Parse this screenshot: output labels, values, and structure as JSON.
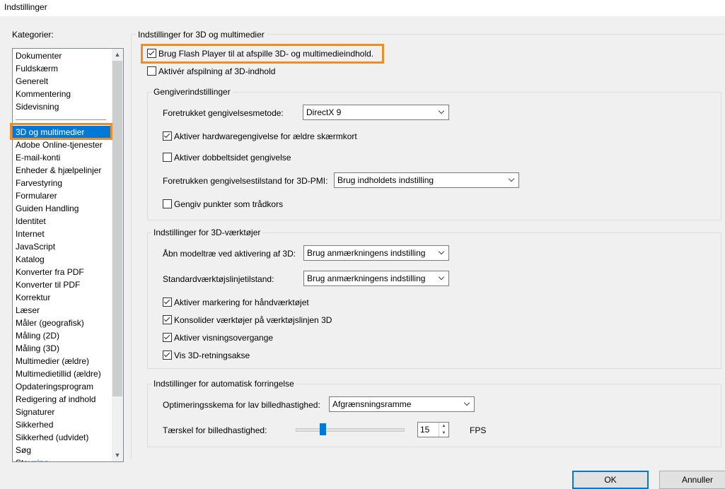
{
  "window": {
    "title": "Indstillinger"
  },
  "categories": {
    "label": "Kategorier:",
    "items_top": [
      "Dokumenter",
      "Fuldskærm",
      "Generelt",
      "Kommentering",
      "Sidevisning"
    ],
    "selected": "3D og multimedier",
    "items": [
      "Adobe Online-tjenester",
      "E-mail-konti",
      "Enheder & hjælpelinjer",
      "Farvestyring",
      "Formularer",
      "Guiden Handling",
      "Identitet",
      "Internet",
      "JavaScript",
      "Katalog",
      "Konverter fra PDF",
      "Konverter til PDF",
      "Korrektur",
      "Læser",
      "Måler (geografisk)",
      "Måling (2D)",
      "Måling (3D)",
      "Multimedier (ældre)",
      "Multimedietillid (ældre)",
      "Opdateringsprogram",
      "Redigering af indhold",
      "Signaturer",
      "Sikkerhed",
      "Sikkerhed (udvidet)",
      "Søg",
      "Stavning"
    ]
  },
  "main": {
    "section_title": "Indstillinger for 3D og multimedier",
    "flash_checkbox": {
      "label": "Brug Flash Player til at afspille 3D- og multimedieindhold.",
      "checked": true
    },
    "enable_3d_checkbox": {
      "label": "Aktivér afspilning af 3D-indhold",
      "checked": false
    }
  },
  "renderer": {
    "group_title": "Gengiverindstillinger",
    "method_label": "Foretrukket gengivelsesmetode:",
    "method_value": "DirectX 9",
    "hw_checkbox": {
      "label": "Aktiver hardwaregengivelse for ældre skærmkort",
      "checked": true
    },
    "double_checkbox": {
      "label": "Aktiver dobbeltsidet gengivelse",
      "checked": false
    },
    "pmi_label": "Foretrukken gengivelsestilstand for 3D-PMI:",
    "pmi_value": "Brug indholdets indstilling",
    "points_checkbox": {
      "label": "Gengiv punkter som trådkors",
      "checked": false
    }
  },
  "tools": {
    "group_title": "Indstillinger for 3D-værktøjer",
    "tree_label": "Åbn modeltræ ved aktivering af 3D:",
    "tree_value": "Brug anmærkningens indstilling",
    "toolbar_label": "Standardværktøjslinjetilstand:",
    "toolbar_value": "Brug anmærkningens indstilling",
    "hand_checkbox": {
      "label": "Aktiver markering for håndværktøjet",
      "checked": true
    },
    "consolidate_checkbox": {
      "label": "Konsolider værktøjer på værktøjslinjen 3D",
      "checked": true
    },
    "transitions_checkbox": {
      "label": "Aktiver visningsovergange",
      "checked": true
    },
    "axis_checkbox": {
      "label": "Vis 3D-retningsakse",
      "checked": true
    }
  },
  "degradation": {
    "group_title": "Indstillinger for automatisk forringelse",
    "scheme_label": "Optimeringsskema for lav billedhastighed:",
    "scheme_value": "Afgrænsningsramme",
    "threshold_label": "Tærskel for billedhastighed:",
    "threshold_value": "15",
    "threshold_unit": "FPS",
    "slider_fraction": 0.25
  },
  "buttons": {
    "ok": "OK",
    "cancel": "Annuller"
  },
  "colors": {
    "accent": "#0078d7",
    "highlight": "#ea8e2c"
  }
}
